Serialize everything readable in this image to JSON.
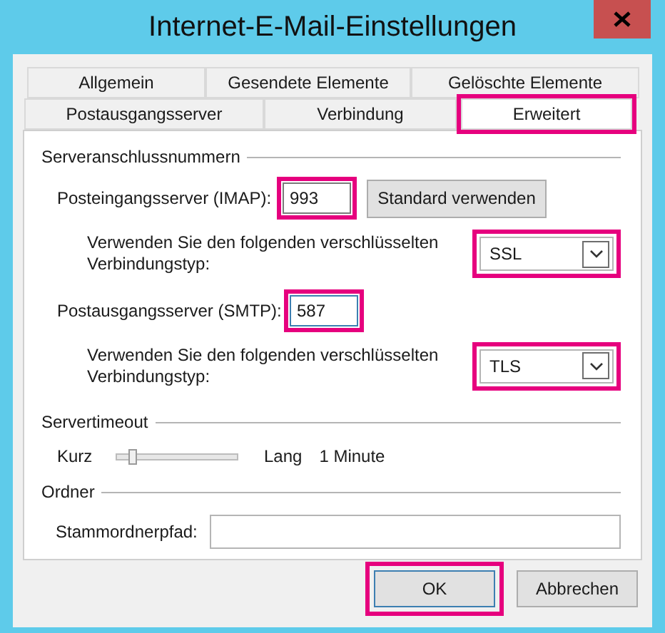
{
  "window": {
    "title": "Internet-E-Mail-Einstellungen"
  },
  "tab_rows": [
    [
      {
        "label": "Allgemein",
        "selected": false,
        "highlighted": false
      },
      {
        "label": "Gesendete Elemente",
        "selected": false,
        "highlighted": false
      },
      {
        "label": "Gelöschte Elemente",
        "selected": false,
        "highlighted": false
      }
    ],
    [
      {
        "label": "Postausgangsserver",
        "selected": false,
        "highlighted": false
      },
      {
        "label": "Verbindung",
        "selected": false,
        "highlighted": false
      },
      {
        "label": "Erweitert",
        "selected": true,
        "highlighted": true
      }
    ]
  ],
  "server_ports": {
    "title": "Serveranschlussnummern",
    "incoming": {
      "label": "Posteingangsserver (IMAP):",
      "value": "993",
      "highlighted": true,
      "focused": false
    },
    "default_button": {
      "label": "Standard verwenden"
    },
    "incoming_encryption": {
      "label": "Verwenden Sie den folgenden verschlüsselten Verbindungstyp:",
      "value": "SSL",
      "highlighted": true
    },
    "outgoing": {
      "label": "Postausgangsserver (SMTP):",
      "value": "587",
      "highlighted": true,
      "focused": true
    },
    "outgoing_encryption": {
      "label": "Verwenden Sie den folgenden verschlüsselten Verbindungstyp:",
      "value": "TLS",
      "highlighted": true
    }
  },
  "server_timeout": {
    "title": "Servertimeout",
    "min_label": "Kurz",
    "max_label": "Lang",
    "level": 0.1,
    "reading": "1 Minute"
  },
  "folders": {
    "title": "Ordner",
    "root_path": {
      "label": "Stammordnerpfad:"
    }
  },
  "buttons": [
    {
      "label": "OK",
      "default": true,
      "highlighted": true
    },
    {
      "label": "Abbrechen",
      "default": false,
      "highlighted": false
    }
  ]
}
